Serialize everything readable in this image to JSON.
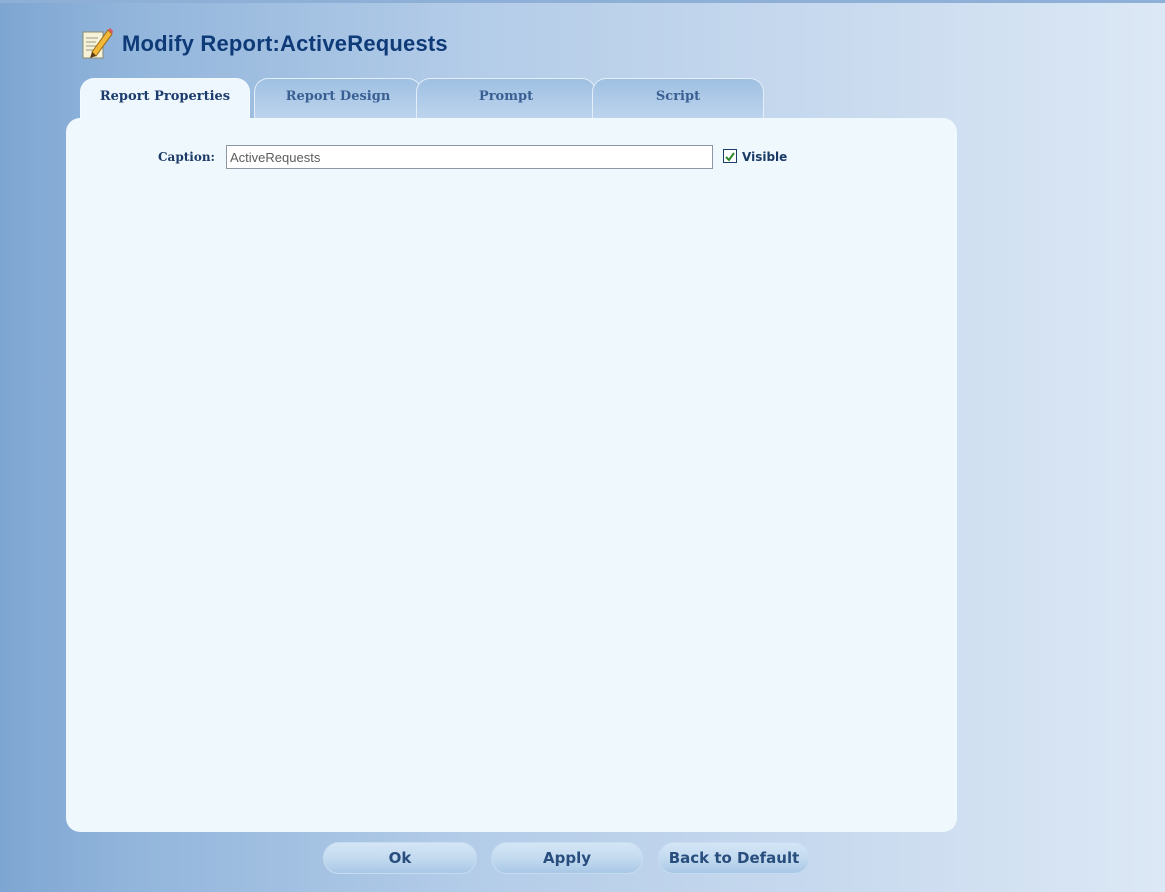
{
  "header": {
    "title": "Modify Report:ActiveRequests",
    "icon": "edit-document-icon"
  },
  "tabs": [
    {
      "label": "Report Properties",
      "active": true
    },
    {
      "label": "Report Design",
      "active": false
    },
    {
      "label": "Prompt",
      "active": false
    },
    {
      "label": "Script",
      "active": false
    }
  ],
  "form": {
    "caption_label": "Caption:",
    "caption_value": "ActiveRequests",
    "visible_label": "Visible",
    "visible_checked": true
  },
  "buttons": {
    "ok": "Ok",
    "apply": "Apply",
    "back_to_default": "Back to Default"
  },
  "colors": {
    "title": "#0f3a78",
    "panel": "#eff8fd",
    "checkmark": "#2a8a2a"
  }
}
